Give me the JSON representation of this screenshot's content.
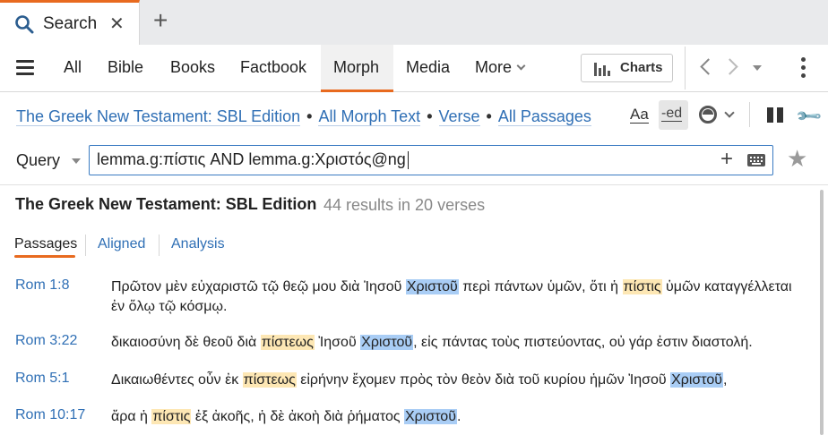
{
  "tab": {
    "label": "Search"
  },
  "nav": {
    "items": [
      "All",
      "Bible",
      "Books",
      "Factbook",
      "Morph",
      "Media",
      "More"
    ],
    "active": "Morph",
    "charts_label": "Charts"
  },
  "filters": {
    "resource": "The Greek New Testament: SBL Edition",
    "text_scope": "All Morph Text",
    "unit": "Verse",
    "range": "All Passages",
    "bullet": "•",
    "aa_label": "Aa",
    "ed_label": "-ed"
  },
  "query": {
    "label": "Query",
    "value": "lemma.g:πίστις AND lemma.g:Χριστός@ng"
  },
  "results": {
    "title": "The Greek New Testament: SBL Edition",
    "count": "44 results in 20 verses",
    "subtabs": [
      "Passages",
      "Aligned",
      "Analysis"
    ],
    "rows": [
      {
        "ref": "Rom 1:8",
        "parts": [
          {
            "t": "Πρῶτον μὲν εὐχαριστῶ τῷ θεῷ μου διὰ Ἰησοῦ ",
            "h": ""
          },
          {
            "t": "Χριστοῦ",
            "h": "christ"
          },
          {
            "t": " περὶ πάντων ὑμῶν, ὅτι ἡ ",
            "h": ""
          },
          {
            "t": "πίστις",
            "h": "faith"
          },
          {
            "t": " ὑμῶν καταγγέλλεται ἐν ὅλῳ τῷ κόσμῳ.",
            "h": ""
          }
        ]
      },
      {
        "ref": "Rom 3:22",
        "parts": [
          {
            "t": "δικαιοσύνη δὲ θεοῦ διὰ ",
            "h": ""
          },
          {
            "t": "πίστεως",
            "h": "faith"
          },
          {
            "t": " Ἰησοῦ ",
            "h": ""
          },
          {
            "t": "Χριστοῦ",
            "h": "christ"
          },
          {
            "t": ", εἰς πάντας τοὺς πιστεύοντας, οὐ γάρ ἐστιν διαστολή.",
            "h": ""
          }
        ]
      },
      {
        "ref": "Rom 5:1",
        "parts": [
          {
            "t": "Δικαιωθέντες οὖν ἐκ ",
            "h": ""
          },
          {
            "t": "πίστεως",
            "h": "faith"
          },
          {
            "t": " εἰρήνην ἔχομεν πρὸς τὸν θεὸν διὰ τοῦ κυρίου ἡμῶν Ἰησοῦ ",
            "h": ""
          },
          {
            "t": "Χριστοῦ",
            "h": "christ"
          },
          {
            "t": ",",
            "h": ""
          }
        ]
      },
      {
        "ref": "Rom 10:17",
        "parts": [
          {
            "t": "ἄρα ἡ ",
            "h": ""
          },
          {
            "t": "πίστις",
            "h": "faith"
          },
          {
            "t": " ἐξ ἀκοῆς, ἡ δὲ ἀκοὴ διὰ ῥήματος ",
            "h": ""
          },
          {
            "t": "Χριστοῦ",
            "h": "christ"
          },
          {
            "t": ".",
            "h": ""
          }
        ]
      }
    ]
  },
  "colors": {
    "accent": "#e86a1f",
    "link": "#2f6fb5",
    "highlight_christ": "#a9cdf5",
    "highlight_faith": "#fde7b4"
  },
  "icons": [
    "search-icon",
    "close-icon",
    "plus-icon",
    "hamburger-icon",
    "bar-chart-icon",
    "back-arrow-icon",
    "forward-arrow-icon",
    "kebab-icon",
    "ring-icon",
    "pause-icon",
    "wrench-icon",
    "keyboard-icon",
    "star-icon"
  ]
}
